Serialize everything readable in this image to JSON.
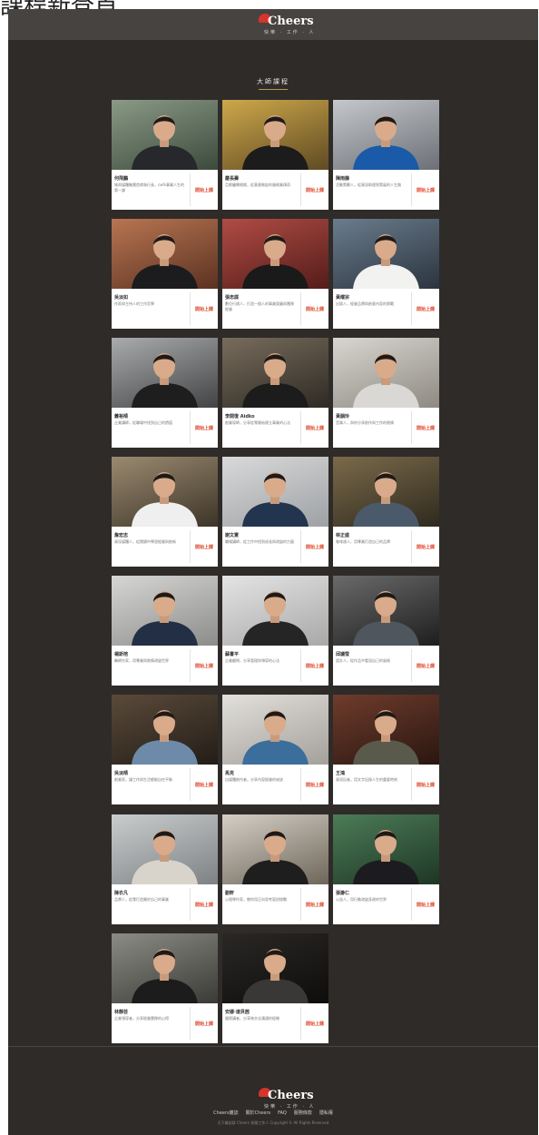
{
  "top_caption": "課程新登首",
  "brand": {
    "name": "Cheers",
    "tagline": "快樂 · 工作 · 人"
  },
  "section_title": "大師課程",
  "cta_label": "開始上課",
  "courses": [
    {
      "name": "何飛鵬",
      "desc": "城邦媒體集團首席執行長，cwfs事業人生的第一課",
      "bg": [
        "#8a9a86",
        "#3c4a3c"
      ],
      "shirt": "#26282c"
    },
    {
      "name": "嚴長壽",
      "desc": "亞都麗緻總裁，從基層做起的服務業傳奇",
      "bg": [
        "#cda84a",
        "#5f4a23"
      ],
      "shirt": "#1c1c1c"
    },
    {
      "name": "陳雨藤",
      "desc": "活動策劃人，從資深助理到策展的人生路",
      "bg": [
        "#c4c8cc",
        "#6c7076"
      ],
      "shirt": "#1b5aa8"
    },
    {
      "name": "吳淡如",
      "desc": "作家與主持人的工作哲學",
      "bg": [
        "#b87552",
        "#5b3221"
      ],
      "shirt": "#1c1c1e"
    },
    {
      "name": "張忠謀",
      "desc": "數位行銷人，打造一個人的事業版圖與團隊經營",
      "bg": [
        "#b04c44",
        "#541c1a"
      ],
      "shirt": "#1a1a1a"
    },
    {
      "name": "黃曜宗",
      "desc": "出版人，經營品牌與創意內容的實戰",
      "bg": [
        "#6a7c8c",
        "#2c3440"
      ],
      "shirt": "#f2f2f0"
    },
    {
      "name": "蕭裕晴",
      "desc": "企業講師，從職場中找到自己的價值",
      "bg": [
        "#a9abad",
        "#414345"
      ],
      "shirt": "#1e1e1e"
    },
    {
      "name": "李開復 Aidko",
      "desc": "創業導師，分享從零開始建立事業的心法",
      "bg": [
        "#786c5c",
        "#2e2a24"
      ],
      "shirt": "#1c1c1c"
    },
    {
      "name": "黃韻玲",
      "desc": "音樂人，與你分享創作與工作的熱情",
      "bg": [
        "#d8d6d0",
        "#8e8a82"
      ],
      "shirt": "#d9d8d4"
    },
    {
      "name": "詹宏志",
      "desc": "資深媒體人，從閱讀中學習經營與創新",
      "bg": [
        "#9a8a70",
        "#3d3428"
      ],
      "shirt": "#efefef"
    },
    {
      "name": "謝文憲",
      "desc": "職場講師，從工作中找到成長與改變的力量",
      "bg": [
        "#d8d9da",
        "#9ea1a4"
      ],
      "shirt": "#23344e"
    },
    {
      "name": "林正盛",
      "desc": "咖啡達人，用專業打造自己的品牌",
      "bg": [
        "#7a6a4a",
        "#2f2a1e"
      ],
      "shirt": "#4a5a6a"
    },
    {
      "name": "楊斯棓",
      "desc": "醫師作家，用專業與熱情改變世界",
      "bg": [
        "#d6d6d4",
        "#8c8c8a"
      ],
      "shirt": "#232f45"
    },
    {
      "name": "蘇書平",
      "desc": "企業顧問，分享管理與領導的心法",
      "bg": [
        "#e4e4e4",
        "#a8a8a8"
      ],
      "shirt": "#252525"
    },
    {
      "name": "邱議瑩",
      "desc": "設計人，從作品中看見自己的風格",
      "bg": [
        "#6a6a6a",
        "#1e1e1e"
      ],
      "shirt": "#50565e"
    },
    {
      "name": "吳淡晴",
      "desc": "創業家，讓工作與生活都能自在平衡",
      "bg": [
        "#5a4a3a",
        "#231d17"
      ],
      "shirt": "#6d8aa8"
    },
    {
      "name": "馬克",
      "desc": "自媒體創作者，分享內容經營的祕訣",
      "bg": [
        "#e2e0dc",
        "#a4a09a"
      ],
      "shirt": "#3c6e9c"
    },
    {
      "name": "王鴻",
      "desc": "資深記者，用文字記錄人生的重要時刻",
      "bg": [
        "#6e3c2c",
        "#2a1610"
      ],
      "shirt": "#5a5a4c"
    },
    {
      "name": "陳衣凡",
      "desc": "品牌人，從零打造屬於自己的事業",
      "bg": [
        "#c9cccd",
        "#7e8284"
      ],
      "shirt": "#d8d4cc"
    },
    {
      "name": "劉軒",
      "desc": "心理學作家，教你用正向思考面對挑戰",
      "bg": [
        "#d4cfc6",
        "#6e665a"
      ],
      "shirt": "#1e1e1e"
    },
    {
      "name": "張瀞仁",
      "desc": "公益人，用行動改變身邊的世界",
      "bg": [
        "#4c7c58",
        "#1e3624"
      ],
      "shirt": "#1c1c20"
    },
    {
      "name": "林靜芸",
      "desc": "企業領導者，分享經營團隊的心得",
      "bg": [
        "#8c8c86",
        "#3a3a36"
      ],
      "shirt": "#1c1c1c"
    },
    {
      "name": "安娜·達貝茜",
      "desc": "國際講者，分享跨文化溝通的經驗",
      "bg": [
        "#2a2826",
        "#0e0d0c"
      ],
      "shirt": "#3a3836"
    }
  ],
  "footer": {
    "links": [
      "Cheers雜誌",
      "關於Cheers",
      "FAQ",
      "服務條款",
      "隱私權"
    ],
    "copyright": "天下雜誌群 Cheers 快樂工作人 Copyright © All Rights Reserved"
  }
}
